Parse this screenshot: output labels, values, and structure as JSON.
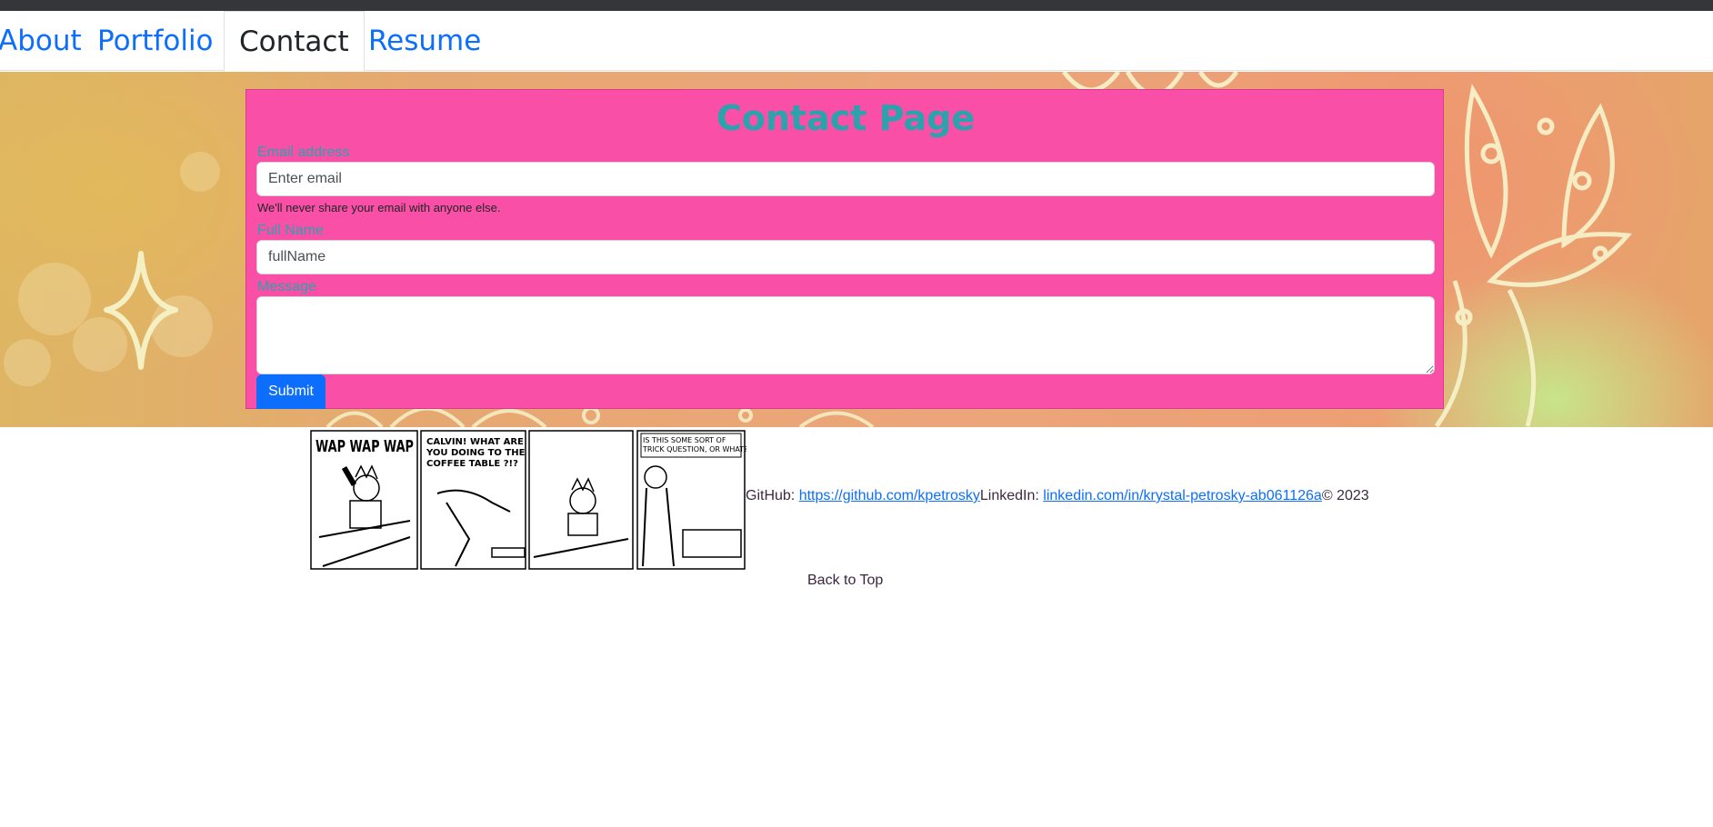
{
  "nav": {
    "tabs": [
      {
        "label": "About"
      },
      {
        "label": "Portfolio"
      },
      {
        "label": "Contact"
      },
      {
        "label": "Resume"
      }
    ],
    "active_tab": "Contact"
  },
  "contact": {
    "title": "Contact Page",
    "email_label": "Email address",
    "email_placeholder": "Enter email",
    "email_help": "We'll never share your email with anyone else.",
    "name_label": "Full Name",
    "name_placeholder": "fullName",
    "message_label": "Message",
    "message_value": "",
    "submit_label": "Submit"
  },
  "comic": {
    "panel1_text": "WAP WAP WAP",
    "panel2_line1": "CALVIN! WHAT ARE",
    "panel2_line2": "YOU DOING TO THE",
    "panel2_line3": "COFFEE TABLE ?!?",
    "panel4_line1": "IS THIS SOME SORT OF",
    "panel4_line2": "TRICK QUESTION, OR WHAT?"
  },
  "footer": {
    "github_label": "GitHub: ",
    "github_link": "https://github.com/kpetrosky",
    "linkedin_label": "LinkedIn: ",
    "linkedin_link": "linkedin.com/in/krystal-petrosky-ab061126a",
    "copyright": "© 2023",
    "back_to_top": "Back to Top"
  },
  "colors": {
    "card_bg": "#f94fa7",
    "title_teal": "#2ba3ad",
    "link_blue": "#0d6efd",
    "submit_blue": "#0d6efd"
  }
}
